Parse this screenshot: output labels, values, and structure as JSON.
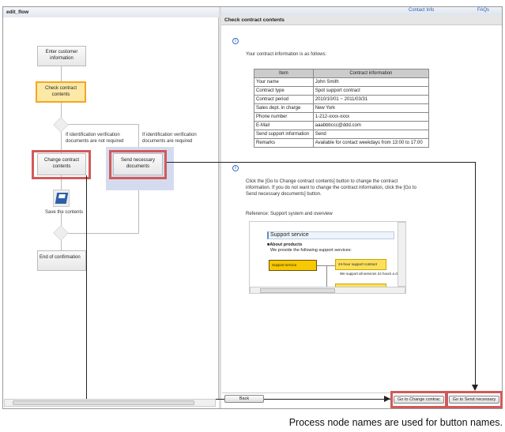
{
  "left_pane": {
    "title": "edit_flow",
    "nodes": {
      "enter": "Enter customer information",
      "check": "Check contract contents",
      "change": "Change contract contents",
      "send": "Send necessary documents",
      "save": "Save the contents",
      "end": "End of confirmation"
    },
    "conditions": {
      "not_required": "If identification verification documents are not required",
      "required": "If identification verification documents are required"
    }
  },
  "top_nav": {
    "contact": "Contact Info",
    "faqs": "FAQs"
  },
  "page": {
    "title": "Check contract contents",
    "intro": "Your contract information is as follows:",
    "table": {
      "headers": [
        "Item",
        "Contract information"
      ],
      "rows": [
        [
          "Your name",
          "John Smith"
        ],
        [
          "Contract type",
          "Spot support contract"
        ],
        [
          "Contract period",
          "2010/10/01 ~ 2011/03/31"
        ],
        [
          "Sales dept. in charge",
          "New York"
        ],
        [
          "Phone number",
          "1-212-xxxx-xxxx"
        ],
        [
          "E-Mail",
          "aaabbbccc@ddd.com"
        ],
        [
          "Send support information",
          "Send"
        ],
        [
          "Remarks",
          "Available for contact weekdays from 13:00 to 17:00"
        ]
      ]
    },
    "instruction": "Click the [Go to Change contract contents] button to change the contract information. If you do not want to change the contract information, click the [Go to Send necessary documents] button.",
    "reference": "Reference: Support system and overview",
    "embedded": {
      "heading": "Support service",
      "subheading": "About products",
      "desc": "We provide the following support services:",
      "box1": "Support service",
      "box2": "24-hour support contract",
      "note": "We support all services 24 hours a d"
    }
  },
  "buttons": {
    "back": "Back",
    "change": "Go to Change contrac",
    "send": "Go to Send necessary"
  },
  "caption": "Process node names are used for button names.",
  "colors": {
    "highlight": "#d05a5a",
    "active_node": "#f5a623",
    "link": "#2a5bb5"
  }
}
